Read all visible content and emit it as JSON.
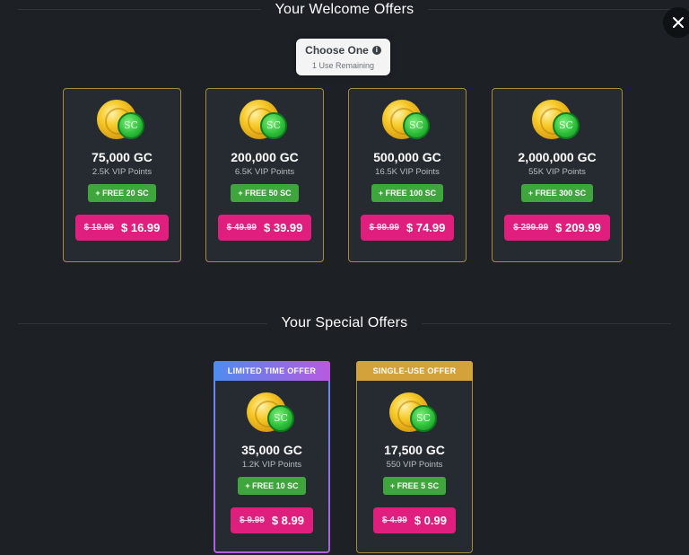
{
  "welcome": {
    "title": "Your Welcome Offers"
  },
  "choose": {
    "title": "Choose One",
    "subtitle": "1 Use Remaining"
  },
  "welcome_offers": [
    {
      "amount": "75,000 GC",
      "vip": "2.5K VIP Points",
      "free": "+ FREE 20 SC",
      "old_price": "$ 19.99",
      "new_price": "$ 16.99"
    },
    {
      "amount": "200,000 GC",
      "vip": "6.5K VIP Points",
      "free": "+ FREE 50 SC",
      "old_price": "$ 49.99",
      "new_price": "$ 39.99"
    },
    {
      "amount": "500,000 GC",
      "vip": "16.5K VIP Points",
      "free": "+ FREE 100 SC",
      "old_price": "$ 99.99",
      "new_price": "$ 74.99"
    },
    {
      "amount": "2,000,000 GC",
      "vip": "55K VIP Points",
      "free": "+ FREE 300 SC",
      "old_price": "$ 299.99",
      "new_price": "$ 209.99"
    }
  ],
  "special": {
    "title": "Your Special Offers"
  },
  "special_offers": [
    {
      "header": "LIMITED TIME OFFER",
      "amount": "35,000 GC",
      "vip": "1.2K VIP Points",
      "free": "+ FREE 10 SC",
      "old_price": "$ 9.99",
      "new_price": "$ 8.99"
    },
    {
      "header": "SINGLE-USE OFFER",
      "amount": "17,500 GC",
      "vip": "550 VIP Points",
      "free": "+ FREE 5 SC",
      "old_price": "$ 4.99",
      "new_price": "$ 0.99"
    }
  ],
  "coin_label": "SC",
  "icons": {
    "close": "close-icon",
    "info": "info-icon"
  },
  "colors": {
    "background": "#1d2126",
    "card_border": "#a58a3c",
    "price_button": "#e01e7e",
    "free_badge": "#3ea63c",
    "single_header": "#d4a23a"
  }
}
